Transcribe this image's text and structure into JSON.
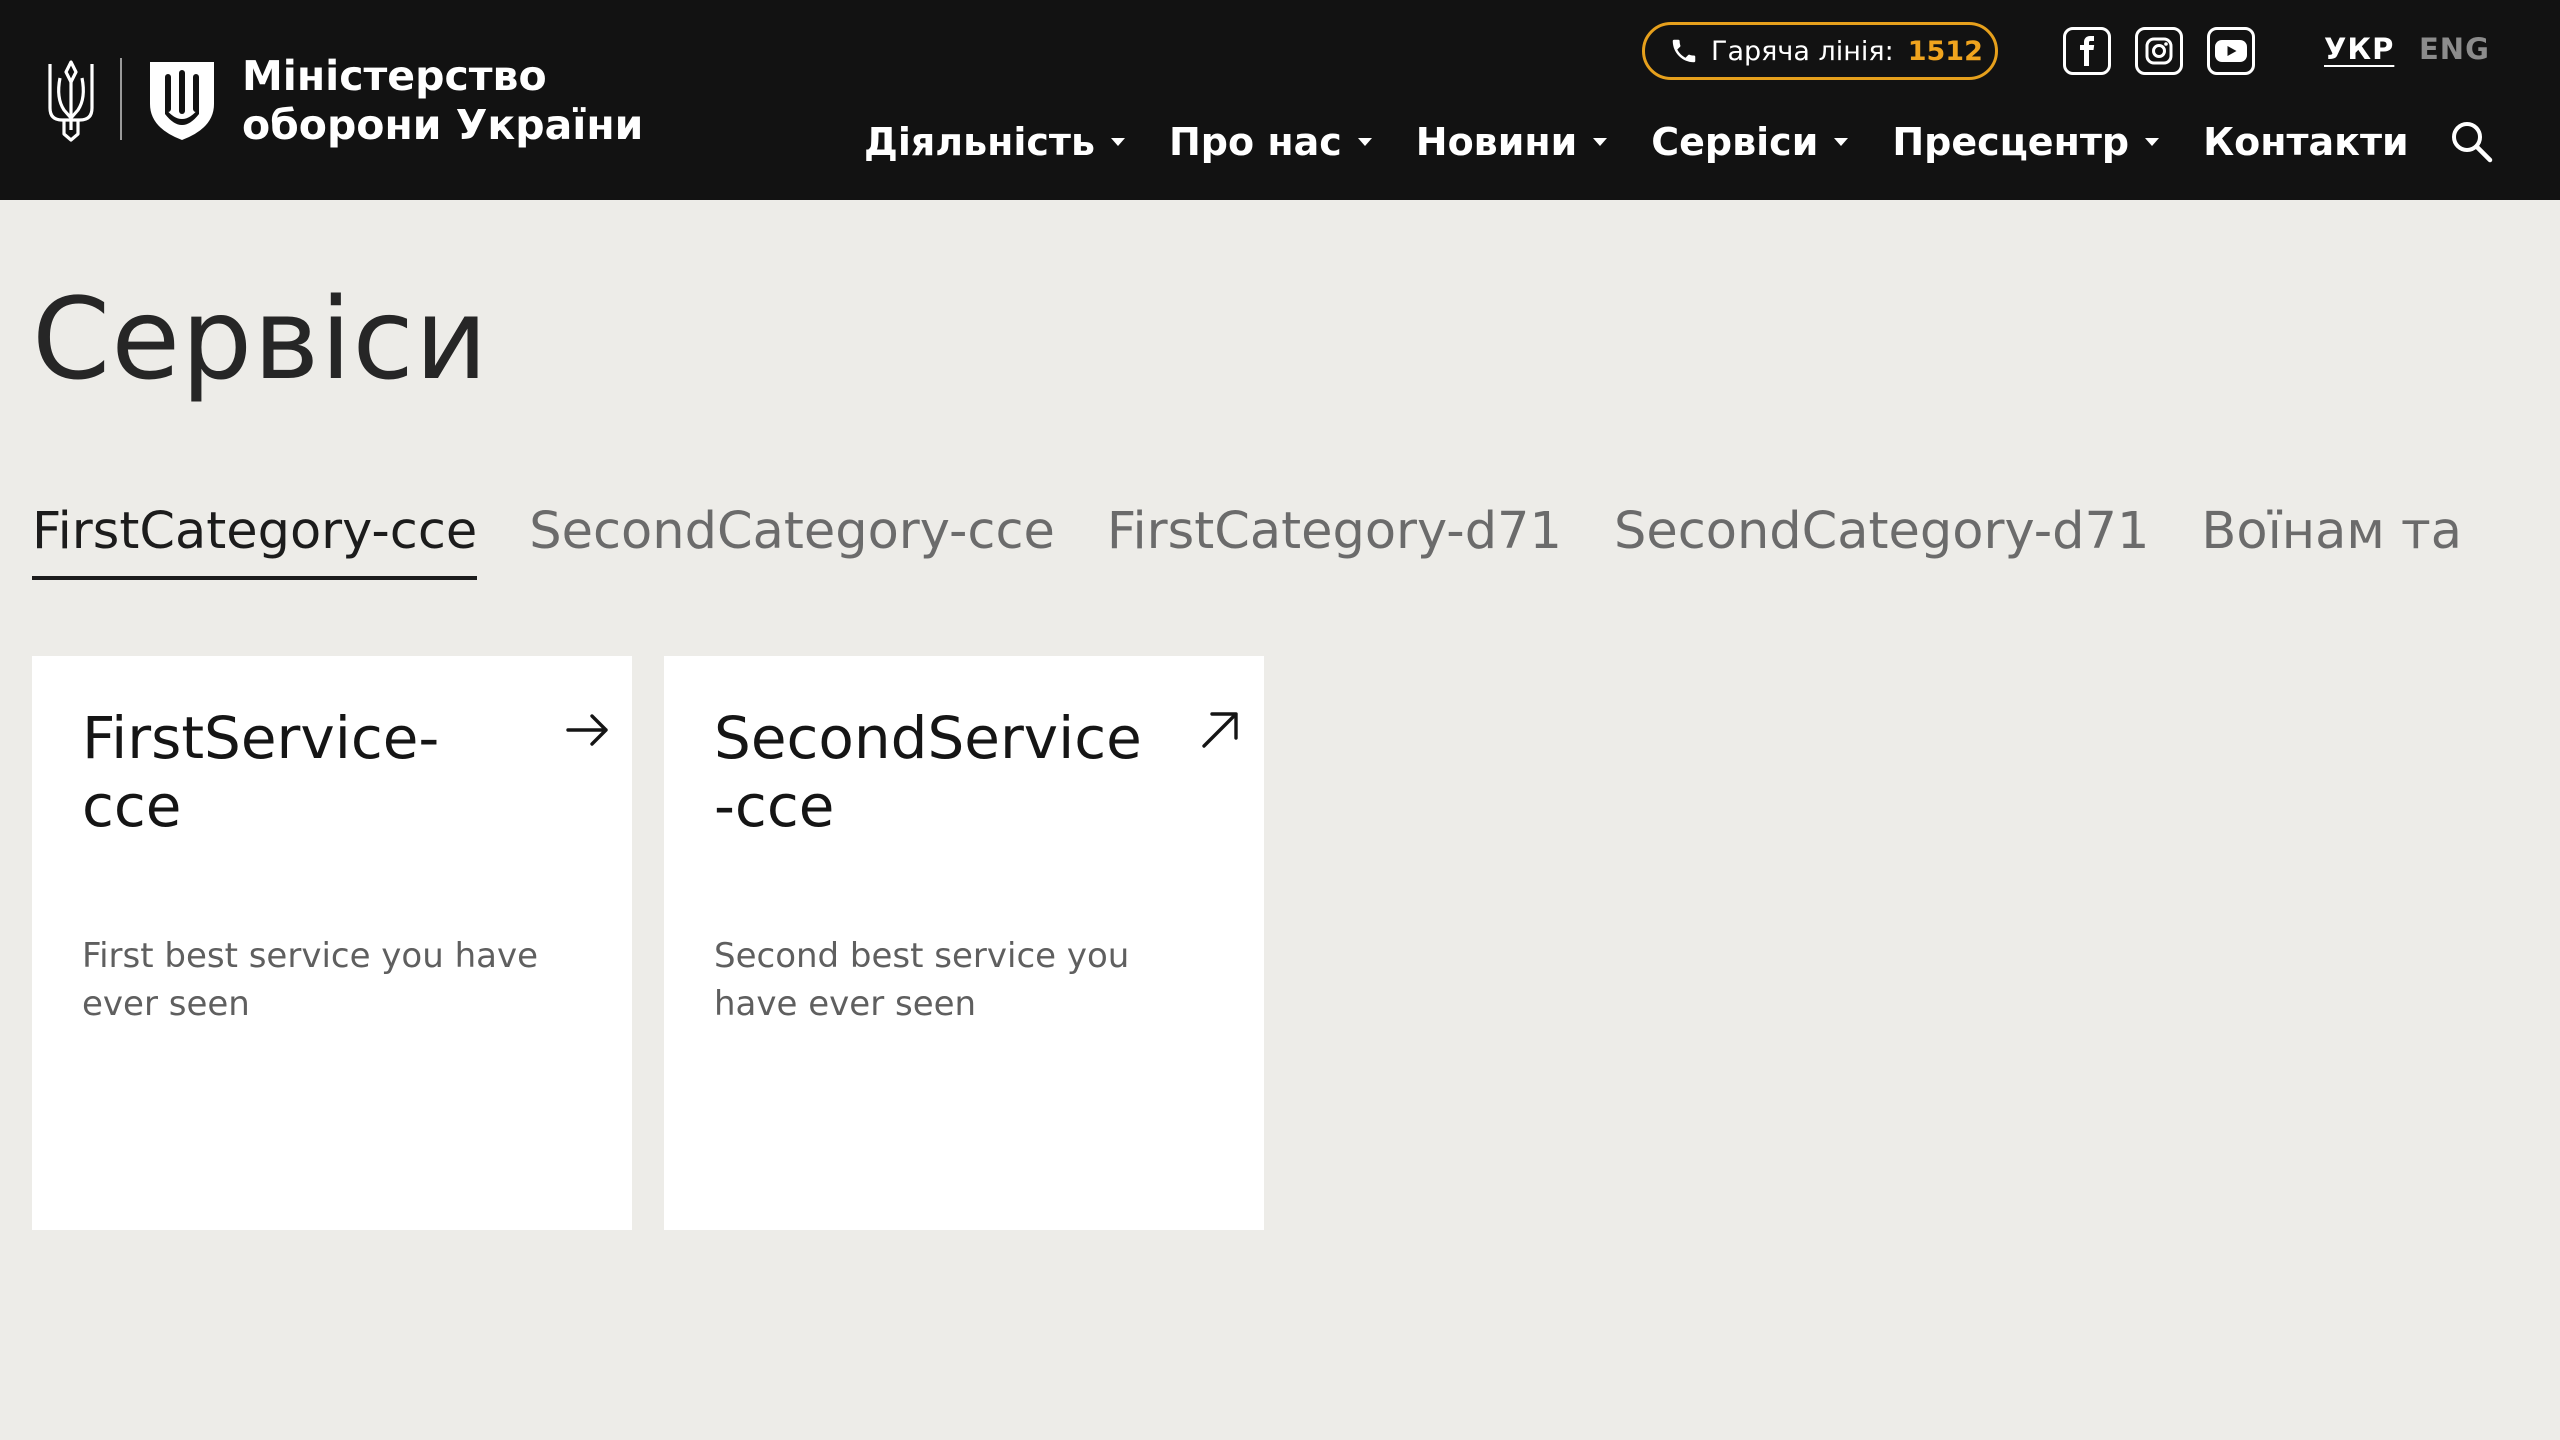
{
  "header": {
    "logo_line1": "Міністерство",
    "logo_line2": "оборони України",
    "hotline_label": "Гаряча лінія:",
    "hotline_number": "1512",
    "socials": [
      "facebook-icon",
      "instagram-icon",
      "youtube-icon"
    ],
    "languages": [
      {
        "label": "УКР",
        "active": true
      },
      {
        "label": "ENG",
        "active": false
      }
    ],
    "nav": [
      {
        "label": "Діяльність",
        "has_dropdown": true
      },
      {
        "label": "Про нас",
        "has_dropdown": true
      },
      {
        "label": "Новини",
        "has_dropdown": true
      },
      {
        "label": "Сервіси",
        "has_dropdown": true
      },
      {
        "label": "Пресцентр",
        "has_dropdown": true
      },
      {
        "label": "Контакти",
        "has_dropdown": false
      }
    ],
    "search_icon": "search-icon"
  },
  "main": {
    "title": "Сервіси",
    "tabs": [
      {
        "label": "FirstCategory-cce",
        "active": true
      },
      {
        "label": "SecondCategory-cce",
        "active": false
      },
      {
        "label": "FirstCategory-d71",
        "active": false
      },
      {
        "label": "SecondCategory-d71",
        "active": false
      },
      {
        "label": "Воїнам та",
        "active": false
      }
    ],
    "cards": [
      {
        "title": "FirstService-cce",
        "description": "First best service you have ever seen",
        "icon": "arrow-right-icon"
      },
      {
        "title": "SecondService-cce",
        "description": "Second best service you have ever seen",
        "icon": "external-link-icon"
      }
    ]
  },
  "colors": {
    "header_bg": "#121212",
    "page_bg": "#edece8",
    "accent": "#f0a41e",
    "card_bg": "#ffffff"
  }
}
